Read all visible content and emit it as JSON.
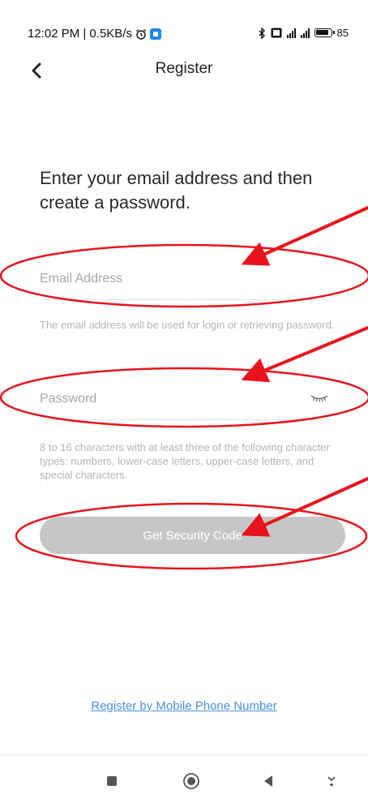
{
  "status_bar": {
    "time_speed": "12:02 PM | 0.5KB/s",
    "battery": "85"
  },
  "header": {
    "title": "Register"
  },
  "main": {
    "heading": "Enter your email address and then create a password.",
    "email": {
      "placeholder": "Email Address",
      "value": "",
      "hint": "The email address will be used for login or retrieving password."
    },
    "password": {
      "placeholder": "Password",
      "value": "",
      "hint": "8 to 16 characters with at least three of the following character types: numbers, lower-case letters, upper-case letters, and special characters."
    },
    "submit_label": "Get Security Code",
    "alt_link": "Register by Mobile Phone Number"
  },
  "icons": {
    "back": "chevron-left-icon",
    "eye": "eye-closed-icon",
    "recents": "square-icon",
    "home": "circle-icon",
    "back_nav": "triangle-left-icon",
    "extra": "chevron-down-icon"
  },
  "colors": {
    "button_disabled": "#c6c6c6",
    "link": "#4a8fd6",
    "annotation": "#e8141b"
  }
}
